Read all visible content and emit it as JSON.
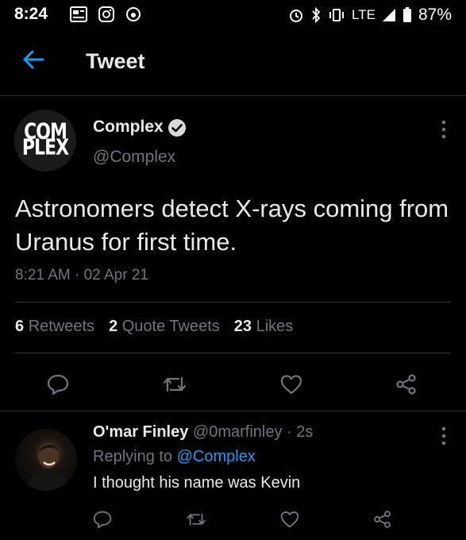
{
  "status_bar": {
    "time": "8:24",
    "network": "LTE",
    "battery": "87%"
  },
  "header": {
    "title": "Tweet"
  },
  "tweet": {
    "author_name": "Complex",
    "author_handle": "@Complex",
    "avatar_text_line1": "COM",
    "avatar_text_line2": "PLEX",
    "text": "Astronomers detect X-rays coming from Uranus for first time.",
    "time": "8:21 AM",
    "date": "02 Apr 21",
    "retweets_count": "6",
    "retweets_label": "Retweets",
    "quote_count": "2",
    "quote_label": "Quote Tweets",
    "likes_count": "23",
    "likes_label": "Likes"
  },
  "reply": {
    "name": "O'mar Finley",
    "handle": "@0marfinley",
    "age": "2s",
    "replying_to_label": "Replying to",
    "replying_to_handle": "@Complex",
    "text": "I thought his name was Kevin"
  },
  "colors": {
    "background": "#000000",
    "accent": "#1d9bf0",
    "muted": "#6e767d"
  }
}
